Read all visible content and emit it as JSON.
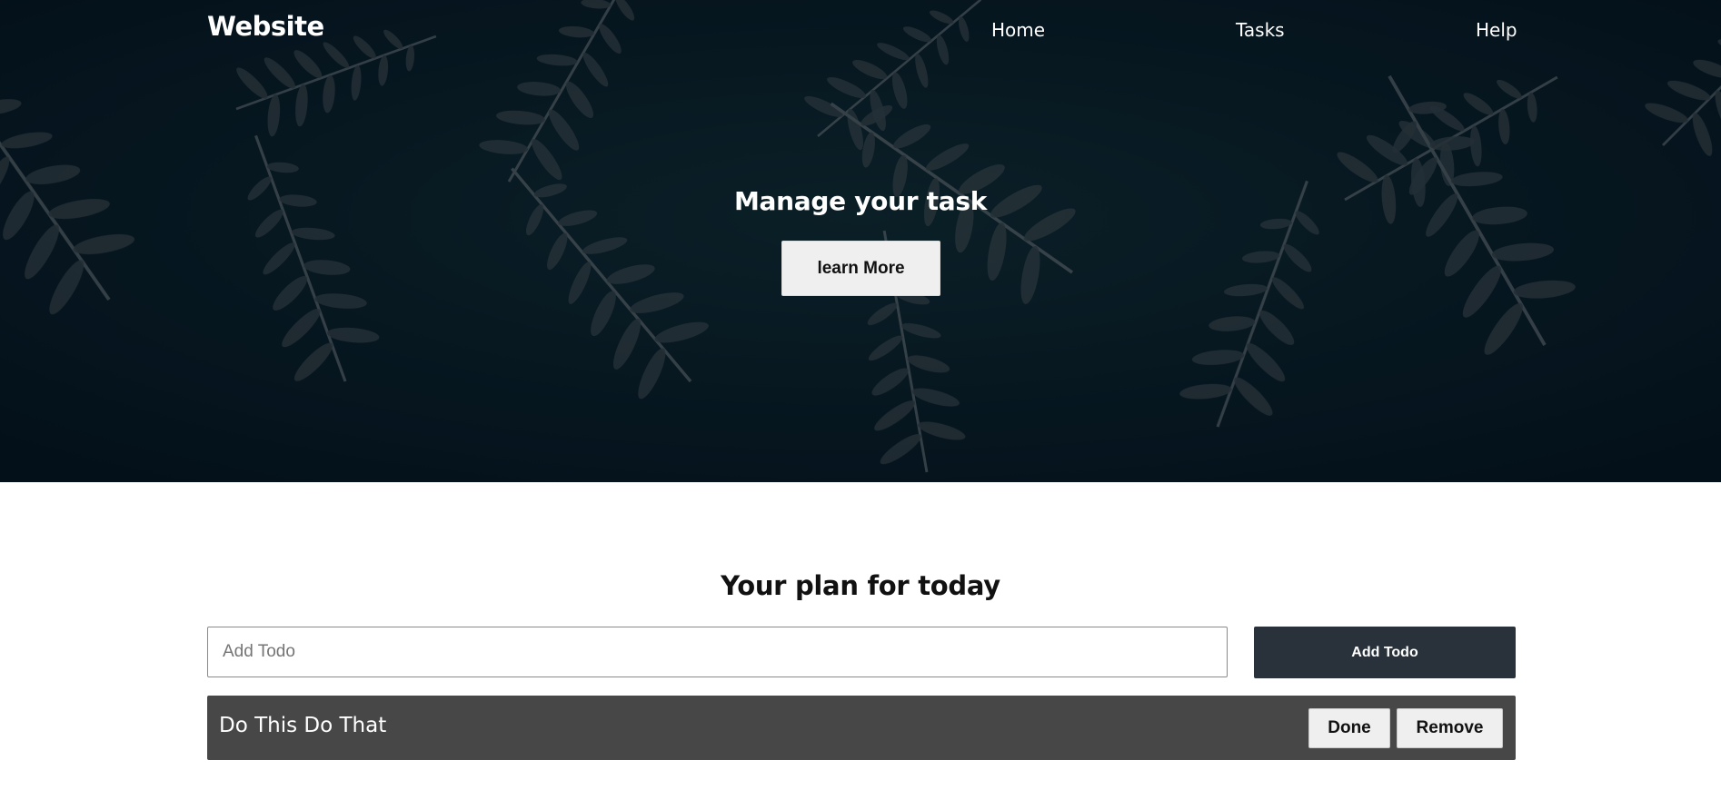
{
  "navbar": {
    "brand": "Website",
    "links": [
      {
        "label": "Home"
      },
      {
        "label": "Tasks"
      },
      {
        "label": "Help"
      }
    ]
  },
  "hero": {
    "title": "Manage your task",
    "button_label": "learn More",
    "background": "dark-fern-leaves-image"
  },
  "todo": {
    "title": "Your plan for today",
    "input_placeholder": "Add Todo",
    "input_value": "",
    "add_button_label": "Add Todo",
    "items": [
      {
        "text": "Do This Do That",
        "done_label": "Done",
        "remove_label": "Remove"
      }
    ]
  },
  "colors": {
    "hero_background": "#05141b",
    "add_button": "#29323a",
    "todo_item_background": "#474747",
    "button_light": "#efefef"
  }
}
